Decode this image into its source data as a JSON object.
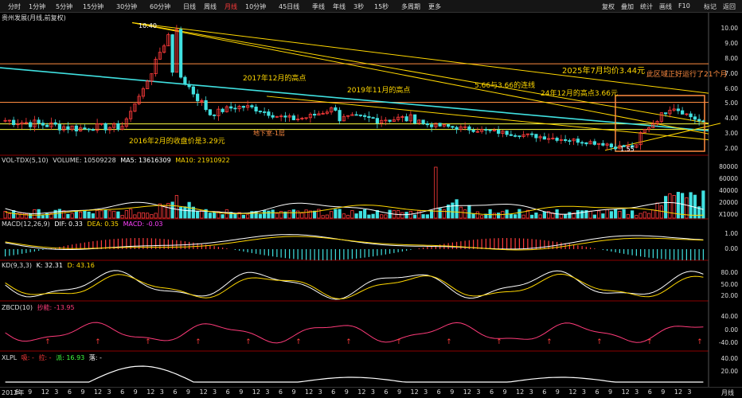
{
  "toolbar": {
    "periods": [
      "分时",
      "1分钟",
      "5分钟",
      "15分钟",
      "30分钟",
      "60分钟",
      "日线",
      "周线",
      "月线",
      "10分钟",
      "45日线",
      "季线",
      "年线",
      "3秒",
      "15秒",
      "多周期",
      "更多"
    ],
    "active_period": "月线",
    "right_buttons": [
      "复权",
      "叠加",
      "统计",
      "画线",
      "F10",
      "标记",
      "返回"
    ]
  },
  "title": "贵州发展(月线,前复权)",
  "price_axis": {
    "ticks": [
      "10.00",
      "9.00",
      "8.00",
      "7.00",
      "6.00",
      "5.00",
      "4.00",
      "3.00",
      "2.00"
    ]
  },
  "annotations": {
    "high_label": "10.40",
    "low_label": "1.55",
    "a1": "2017年12月的高点",
    "a2": "2019年11月的高点",
    "a3": "5.66与3.66的连线",
    "a4": "2025年7月均价3.44元",
    "a5": "24年12月的高点3.66元",
    "a6": "此区域正好运行了21个月",
    "a7": "2016年2月的收盘价是3.29元",
    "a8": "地下室-1层"
  },
  "vol_panel": {
    "name": "VOL-TDX(5,10)",
    "volume_label": "VOLUME: 10509228",
    "ma5_label": "MA5: 13616309",
    "ma10_label": "MA10: 21910922",
    "ticks": [
      "80000",
      "60000",
      "40000",
      "20000",
      "X1000"
    ]
  },
  "macd_panel": {
    "name": "MACD(12,26,9)",
    "dif_label": "DIF: 0.33",
    "dea_label": "DEA: 0.35",
    "macd_label": "MACD: -0.03",
    "ticks": [
      "1.00",
      "0.00"
    ]
  },
  "kd_panel": {
    "name": "KD(9,3,3)",
    "k_label": "K: 32.31",
    "d_label": "D: 43.16",
    "ticks": [
      "80.00",
      "50.00",
      "20.00"
    ]
  },
  "zbcd_panel": {
    "name": "ZBCD(10)",
    "val_label": "抄能: -13.95",
    "ticks": [
      "40.00",
      "0.00",
      "-40.00"
    ]
  },
  "xlpl_panel": {
    "name": "XLPL",
    "l1": "吸: -",
    "l2": "拉: -",
    "l3": "派: 16.93",
    "l4": "落: -",
    "ticks": [
      "40.00",
      "20.00"
    ]
  },
  "xaxis": {
    "labels": [
      "2012年",
      "6",
      "9",
      "12",
      "3",
      "6",
      "9",
      "12",
      "3",
      "6",
      "9",
      "12",
      "3",
      "6",
      "9",
      "12",
      "3",
      "6",
      "9",
      "12",
      "3",
      "6",
      "9",
      "12",
      "3",
      "6",
      "9",
      "12",
      "3",
      "6",
      "9",
      "12",
      "3",
      "6",
      "9",
      "12",
      "3",
      "6",
      "9",
      "12",
      "3",
      "6",
      "9",
      "12",
      "3",
      "6",
      "9",
      "12",
      "3",
      "6",
      "9",
      "12",
      "3"
    ],
    "right_label": "月线"
  },
  "colors": {
    "up": "#ff3b3b",
    "down": "#40e0e0",
    "yellow": "#ffd700",
    "cyan_line": "#40e0e0",
    "orange": "#ff8c40"
  }
}
